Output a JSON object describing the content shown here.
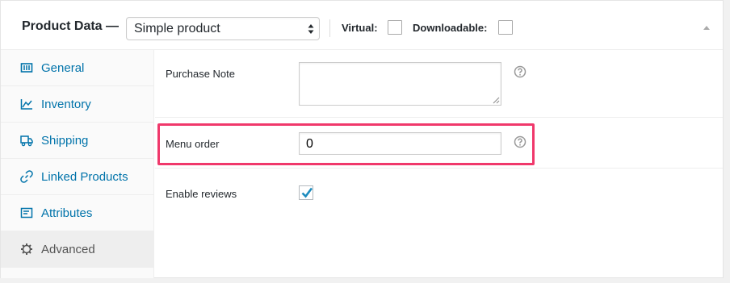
{
  "header": {
    "title": "Product Data —",
    "product_type": "Simple product",
    "virtual_label": "Virtual:",
    "downloadable_label": "Downloadable:",
    "virtual_checked": false,
    "downloadable_checked": false
  },
  "sidebar": {
    "items": [
      {
        "label": "General",
        "icon": "general-grid-icon",
        "active": false
      },
      {
        "label": "Inventory",
        "icon": "inventory-chart-icon",
        "active": false
      },
      {
        "label": "Shipping",
        "icon": "shipping-truck-icon",
        "active": false
      },
      {
        "label": "Linked Products",
        "icon": "link-icon",
        "active": false
      },
      {
        "label": "Attributes",
        "icon": "attributes-list-icon",
        "active": false
      },
      {
        "label": "Advanced",
        "icon": "gear-icon",
        "active": true
      }
    ]
  },
  "fields": {
    "purchase_note": {
      "label": "Purchase Note",
      "value": ""
    },
    "menu_order": {
      "label": "Menu order",
      "value": "0"
    },
    "enable_reviews": {
      "label": "Enable reviews",
      "checked": true
    }
  },
  "colors": {
    "link": "#0073aa",
    "highlight": "#f0386b",
    "checkmark": "#1e8cbe"
  }
}
